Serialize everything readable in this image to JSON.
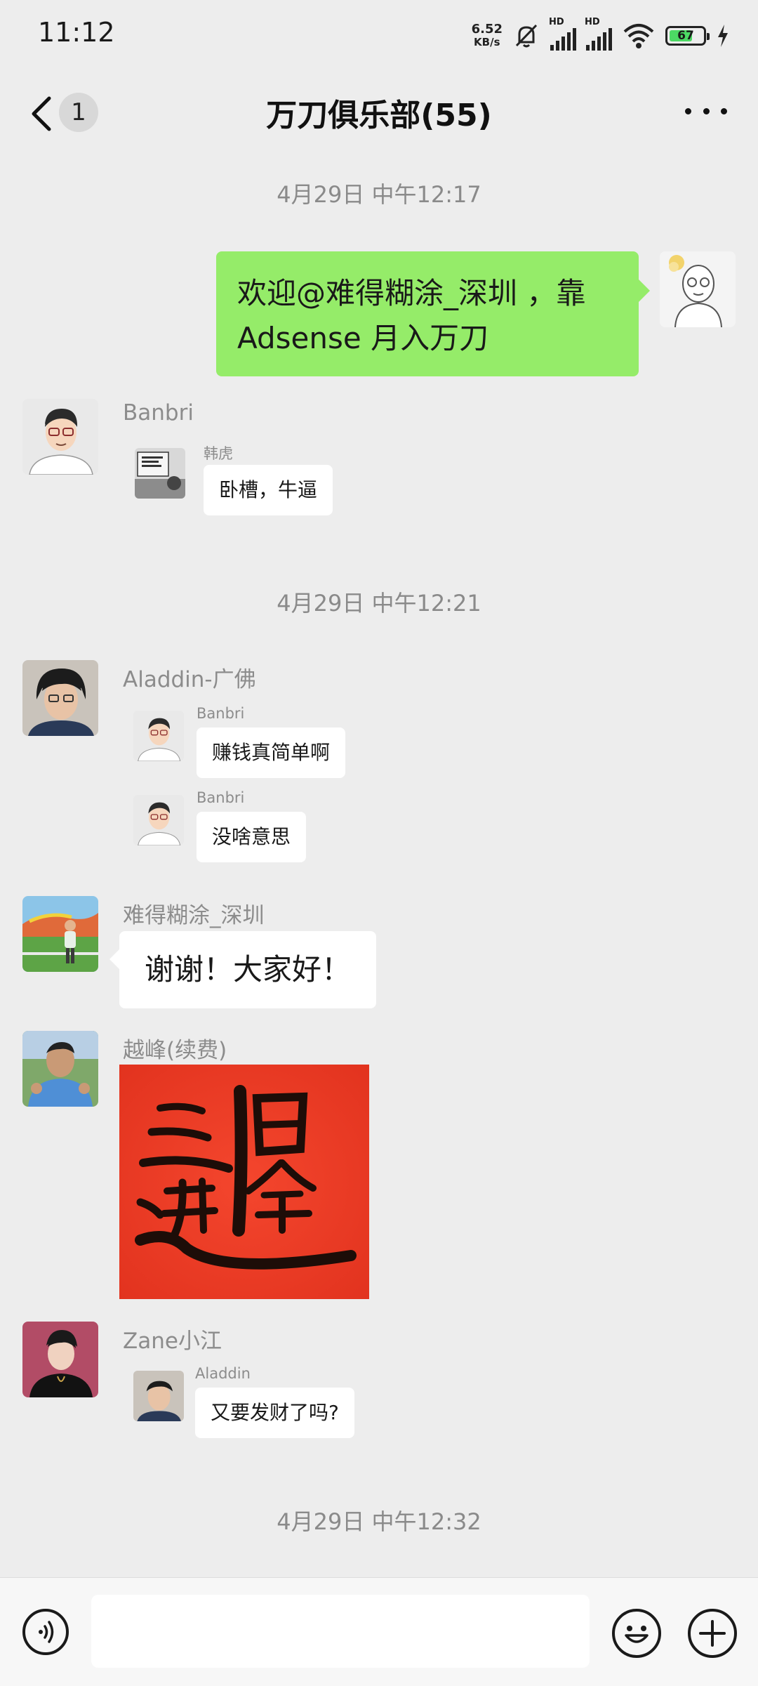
{
  "status_bar": {
    "time": "11:12",
    "net_speed_value": "6.52",
    "net_speed_unit": "KB/s",
    "signal_label": "HD",
    "battery_level": "67",
    "icons": [
      "mute-bell-icon",
      "signal-icon",
      "signal-icon",
      "wifi-icon",
      "battery-icon",
      "charging-icon"
    ]
  },
  "header": {
    "unread_count": "1",
    "title": "万刀俱乐部(55)",
    "icons": [
      "back-icon",
      "more-icon"
    ]
  },
  "messages": {
    "ts1": "4月29日 中午12:17",
    "own_msg": "欢迎@难得糊涂_深圳 ，靠Adsense 月入万刀",
    "m1_sender": "Banbri",
    "m1_reply_name": "韩虎",
    "m1_reply_text": "卧槽，牛逼",
    "ts2": "4月29日 中午12:21",
    "m2_sender": "Aladdin-广佛",
    "m2_reply1_name": "Banbri",
    "m2_reply1_text": "赚钱真简单啊",
    "m2_reply2_name": "Banbri",
    "m2_reply2_text": "没啥意思",
    "m3_sender": "难得糊涂_深圳",
    "m3_text": "谢谢！大家好！",
    "m4_sender": "越峰(续费)",
    "m4_image_desc": "招财进宝 calligraphy",
    "m5_sender": "Zane小江",
    "m5_reply_name": "Aladdin",
    "m5_reply_text": "又要发财了吗?",
    "ts3": "4月29日 中午12:32"
  },
  "input_bar": {
    "placeholder": "",
    "icons": [
      "voice-icon",
      "emoji-icon",
      "plus-icon"
    ]
  },
  "colors": {
    "background": "#ededed",
    "own_bubble": "#95ec69",
    "bubble": "#ffffff",
    "timestamp": "#8a8a8a",
    "red_paper": "#f03a24"
  }
}
